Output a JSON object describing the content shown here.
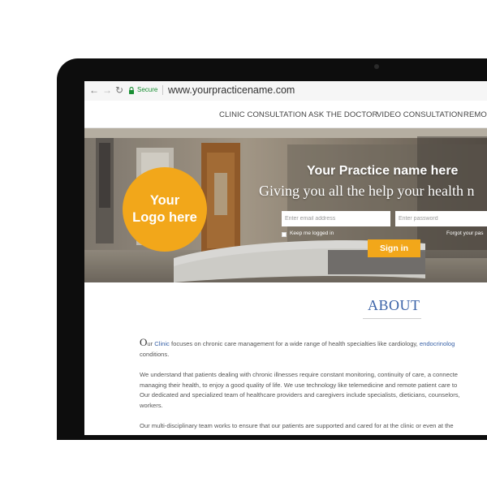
{
  "browser": {
    "back_icon": "arrow-left-icon",
    "forward_icon": "arrow-right-icon",
    "reload_icon": "reload-icon",
    "lock_icon": "lock-icon",
    "secure_label": "Secure",
    "url": "www.yourpracticename.com",
    "secure_color": "#1a8f34"
  },
  "nav": {
    "items": [
      "CLINIC CONSULTATION",
      "ASK THE DOCTOR",
      "VIDEO CONSULTATION",
      "REMOT"
    ]
  },
  "hero": {
    "logo_line1": "Your",
    "logo_line2": "Logo here",
    "title": "Your Practice name here",
    "subtitle": "Giving you all the help your health n",
    "email_placeholder": "Enter email address",
    "password_placeholder": "Enter password",
    "keep_logged_in": "Keep me logged in",
    "forgot": "Forgot your pas",
    "signin": "Sign in",
    "accent_color": "#f2a71a"
  },
  "about": {
    "heading": "ABOUT",
    "p1_first_letter": "O",
    "p1_ur": "ur",
    "p1_clinic": "Clinic",
    "p1_line1_rest": "focuses on chronic care management for a wide range of health specialties like cardiology,",
    "p1_link": "endocrinolog",
    "p1_line2": "conditions.",
    "p2_line1": "We understand that patients dealing with chronic illnesses require constant monitoring, continuity of care, a connecte",
    "p2_line2": "managing their health, to enjoy a good quality of life. We use technology like telemedicine and remote patient care to",
    "p2_line3": "Our dedicated and specialized team of healthcare providers and caregivers include specialists, dieticians, counselors,",
    "p2_line4": "workers.",
    "p3_line1": "Our multi-disciplinary team works to ensure that our patients are supported and cared for at the clinic or even at the",
    "heading_color": "#3b63a8"
  }
}
